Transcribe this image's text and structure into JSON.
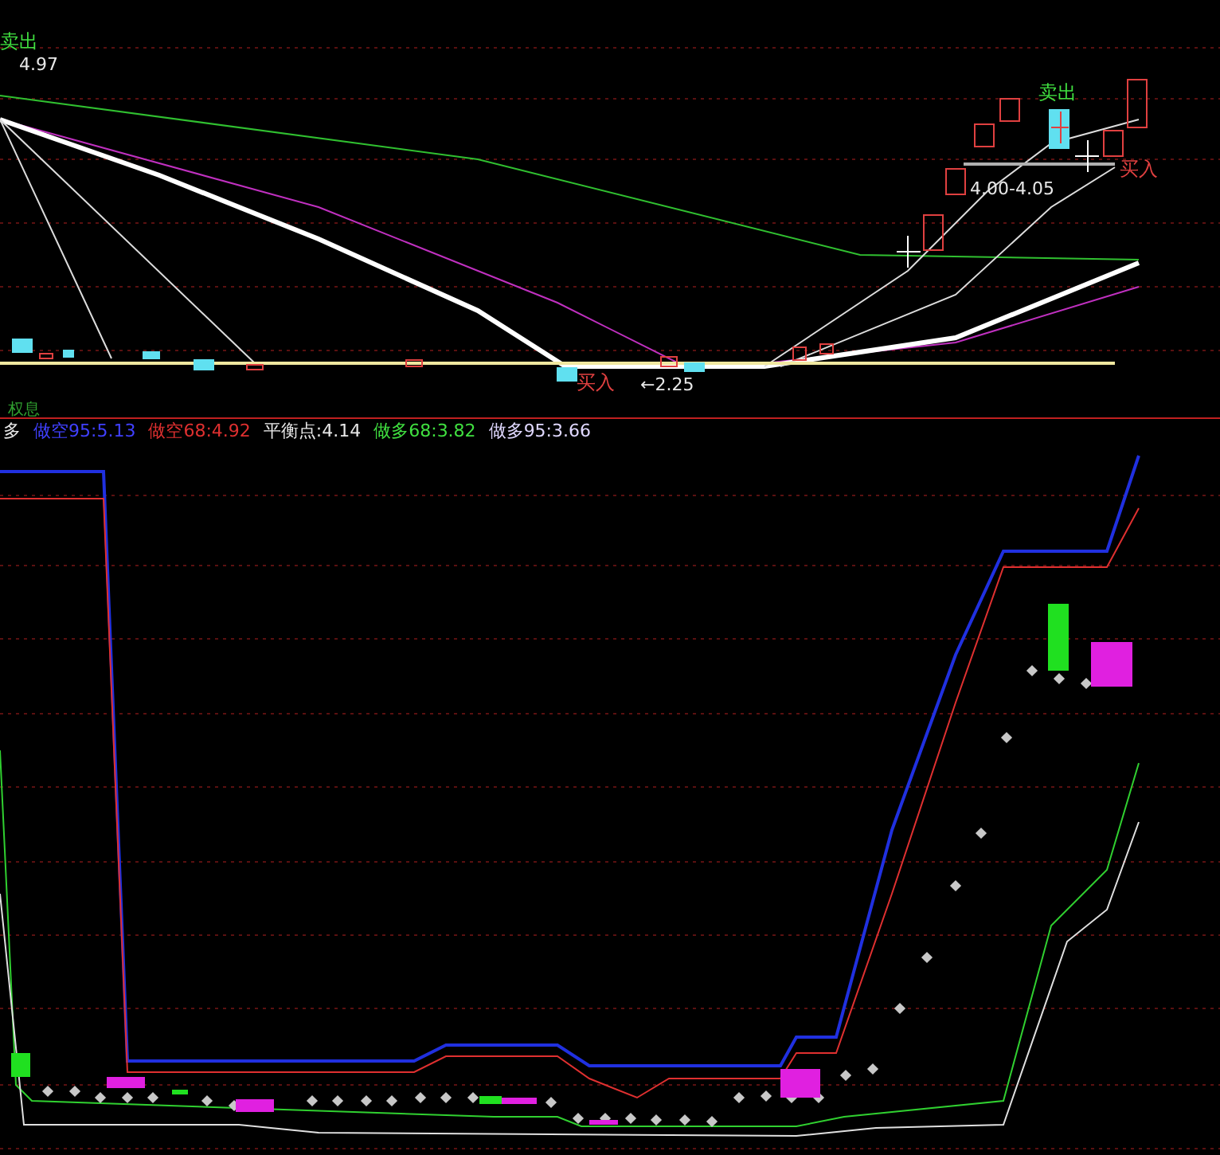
{
  "price_panel": {
    "labels": [
      {
        "text": "卖出",
        "kind": "sell"
      },
      {
        "text": "4.97",
        "kind": "value"
      },
      {
        "text": "卖出",
        "kind": "sell"
      },
      {
        "text": "4.00-4.05",
        "kind": "value"
      },
      {
        "text": "买入",
        "kind": "buy"
      },
      {
        "text": "买入",
        "kind": "buy"
      },
      {
        "text": "←2.25",
        "kind": "value"
      },
      {
        "text": "权息",
        "kind": "note"
      }
    ]
  },
  "indicator_panel": {
    "legend": [
      {
        "text": "多",
        "color": "#e8e8e8"
      },
      {
        "text": "做空95:5.13",
        "color": "#4040ff"
      },
      {
        "text": "做空68:4.92",
        "color": "#e03030"
      },
      {
        "text": "平衡点:4.14",
        "color": "#e8e8e8"
      },
      {
        "text": "做多68:3.82",
        "color": "#40e040"
      },
      {
        "text": "做多95:3.66",
        "color": "#e0d8ff"
      }
    ]
  }
}
